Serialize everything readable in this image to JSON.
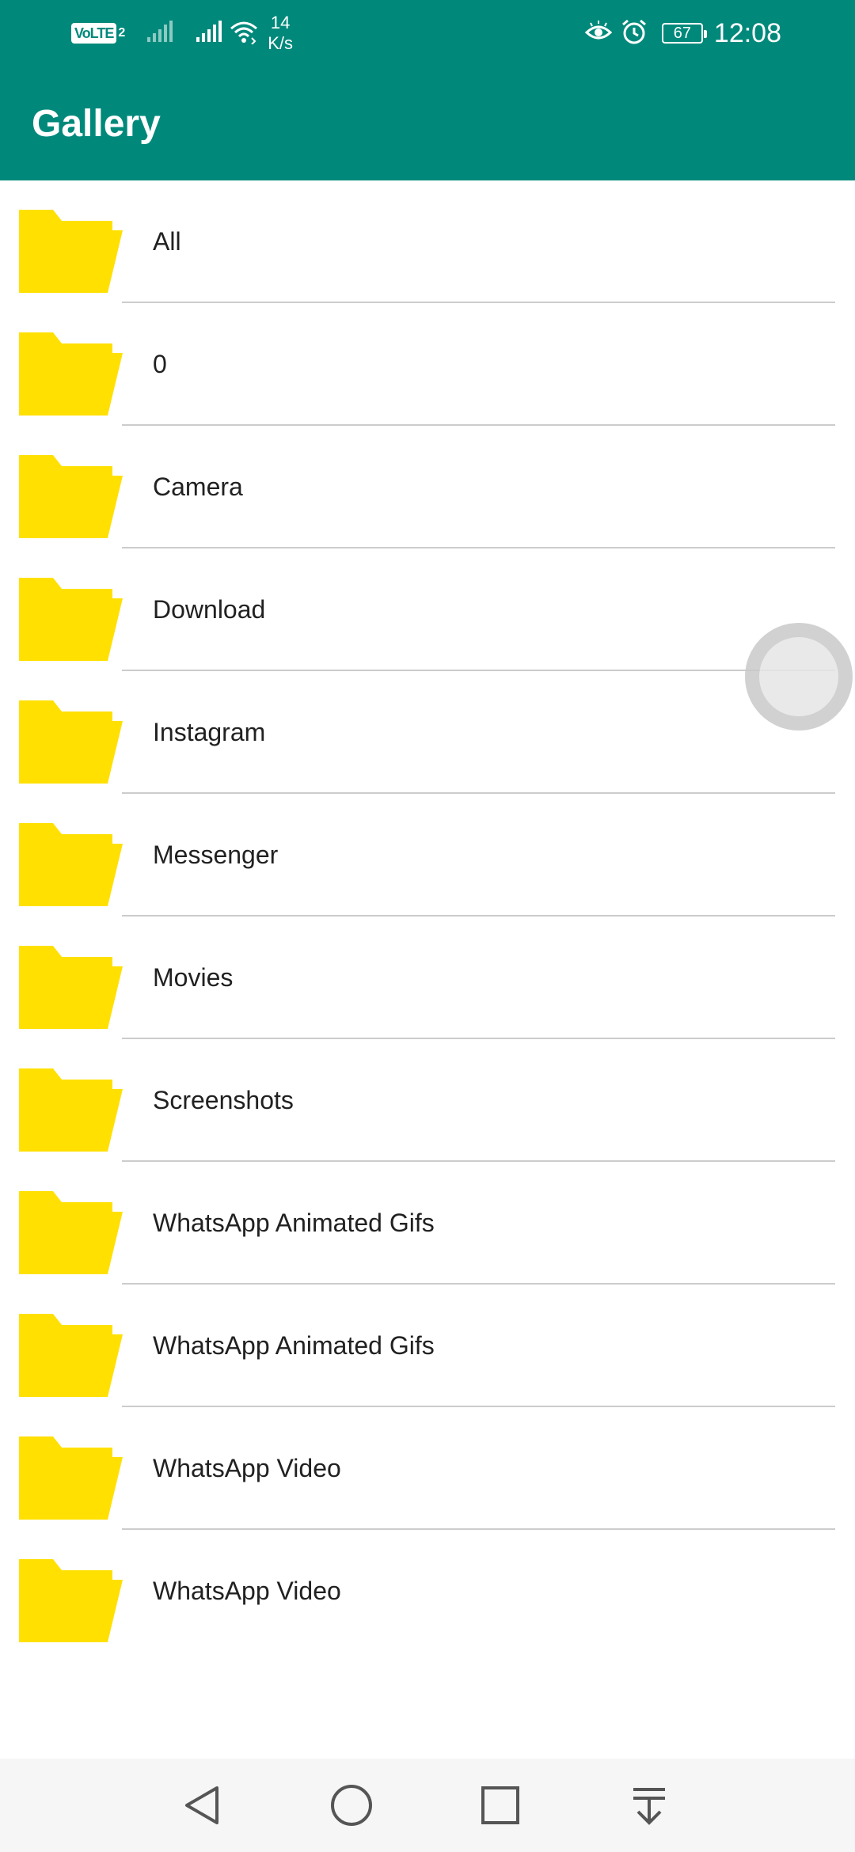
{
  "status_bar": {
    "network_badge": "VoLTE",
    "network_badge_sub": "2",
    "speed_value": "14",
    "speed_unit": "K/s",
    "battery_level": "67",
    "time": "12:08",
    "icons": [
      "signal-1-icon",
      "signal-2-icon",
      "wifi-icon",
      "eye-comfort-icon",
      "alarm-icon",
      "battery-icon"
    ]
  },
  "app_bar": {
    "title": "Gallery"
  },
  "folders": [
    {
      "name": "All",
      "icon": "folder-icon"
    },
    {
      "name": "0",
      "icon": "folder-icon"
    },
    {
      "name": "Camera",
      "icon": "folder-icon"
    },
    {
      "name": "Download",
      "icon": "folder-icon"
    },
    {
      "name": "Instagram",
      "icon": "folder-icon"
    },
    {
      "name": "Messenger",
      "icon": "folder-icon"
    },
    {
      "name": "Movies",
      "icon": "folder-icon"
    },
    {
      "name": "Screenshots",
      "icon": "folder-icon"
    },
    {
      "name": "WhatsApp Animated Gifs",
      "icon": "folder-icon"
    },
    {
      "name": "WhatsApp Animated Gifs",
      "icon": "folder-icon"
    },
    {
      "name": "WhatsApp Video",
      "icon": "folder-icon"
    },
    {
      "name": "WhatsApp Video",
      "icon": "folder-icon"
    }
  ],
  "nav_bar": {
    "buttons": [
      "back-icon",
      "home-icon",
      "recents-icon",
      "notification-pull-icon"
    ]
  },
  "colors": {
    "primary": "#00897B",
    "folder": "#FFE000",
    "divider": "#CCCCCC",
    "text": "#212121"
  }
}
